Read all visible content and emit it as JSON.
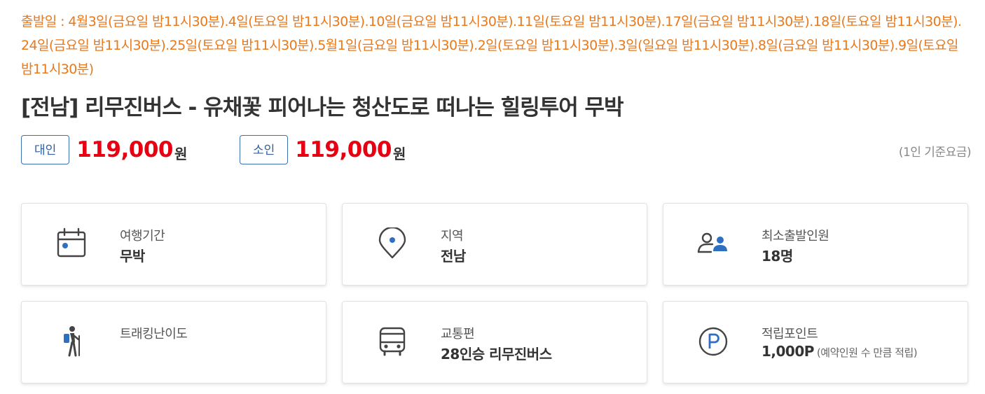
{
  "departure": {
    "text": "출발일 : 4월3일(금요일 밤11시30분).4일(토요일 밤11시30분).10일(금요일 밤11시30분).11일(토요일 밤11시30분).17일(금요일 밤11시30분).18일(토요일 밤11시30분).24일(금요일 밤11시30분).25일(토요일 밤11시30분).5월1일(금요일 밤11시30분).2일(토요일 밤11시30분).3일(일요일 밤11시30분).8일(금요일 밤11시30분).9일(토요일 밤11시30분)"
  },
  "title": "[전남] 리무진버스 - 유채꽃 피어나는 청산도로 떠나는 힐링투어 무박",
  "price": {
    "adult_label": "대인",
    "adult_amount": "119,000",
    "adult_unit": "원",
    "child_label": "소인",
    "child_amount": "119,000",
    "child_unit": "원",
    "note": "(1인 기준요금)"
  },
  "colors": {
    "accent_orange": "#e8791c",
    "price_red": "#e60012",
    "icon_blue": "#2f6fc2"
  },
  "info_cards": [
    {
      "icon": "calendar-icon",
      "label": "여행기간",
      "value": "무박",
      "sub": ""
    },
    {
      "icon": "location-pin-icon",
      "label": "지역",
      "value": "전남",
      "sub": ""
    },
    {
      "icon": "people-icon",
      "label": "최소출발인원",
      "value": "18명",
      "sub": ""
    },
    {
      "icon": "hiker-icon",
      "label": "트래킹난이도",
      "value": "",
      "sub": ""
    },
    {
      "icon": "bus-icon",
      "label": "교통편",
      "value": "28인승 리무진버스",
      "sub": ""
    },
    {
      "icon": "point-icon",
      "label": "적립포인트",
      "value": "1,000P",
      "sub": "(예약인원 수 만큼 적립)"
    }
  ]
}
